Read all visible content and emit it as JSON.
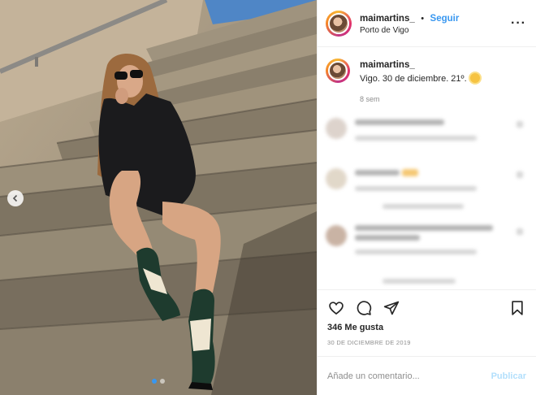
{
  "header": {
    "username": "maimartins_",
    "separator": "•",
    "follow_label": "Seguir",
    "location": "Porto de Vigo",
    "more_icon": "more-dots-icon"
  },
  "caption": {
    "username": "maimartins_",
    "text": "Vigo. 30 de diciembre. 21º.",
    "emoji_icon": "sun-icon",
    "time_ago": "8 sem"
  },
  "blurred_comments_count": 4,
  "actions": {
    "like_icon": "heart-icon",
    "comment_icon": "comment-icon",
    "share_icon": "share-icon",
    "save_icon": "bookmark-icon",
    "likes_text": "346 Me gusta",
    "date": "30 de diciembre de 2019"
  },
  "add_comment": {
    "placeholder": "Añade un comentario...",
    "publish_label": "Publicar"
  },
  "photo": {
    "prev_icon": "chevron-left-icon",
    "carousel_dots": 2,
    "active_dot": 0
  },
  "colors": {
    "accent": "#3897f0",
    "publish_disabled": "#b2dffc",
    "muted": "#8e8e8e"
  }
}
